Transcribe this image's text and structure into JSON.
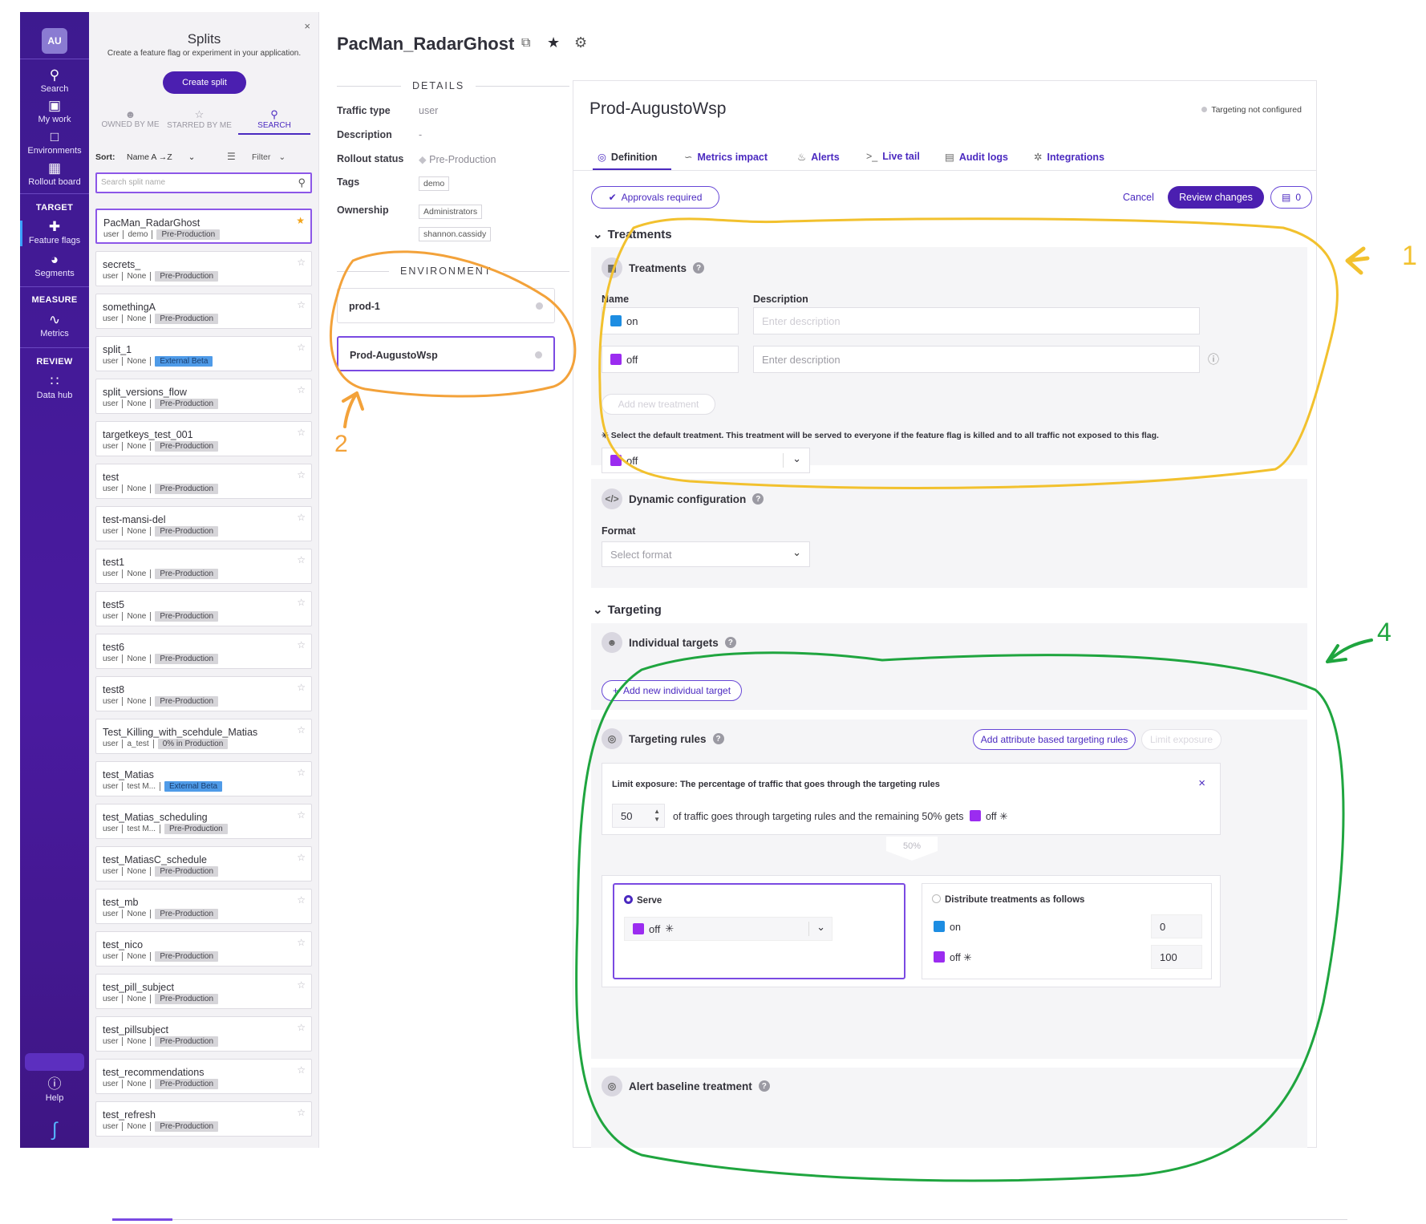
{
  "nav": {
    "avatar": "AU",
    "search": "Search",
    "my_work": "My work",
    "environments": "Environments",
    "rollout_board": "Rollout board",
    "target": "TARGET",
    "feature_flags": "Feature flags",
    "segments": "Segments",
    "measure": "MEASURE",
    "metrics": "Metrics",
    "review": "REVIEW",
    "data_hub": "Data hub",
    "help": "Help"
  },
  "splits_panel": {
    "title": "Splits",
    "subtitle": "Create a feature flag or experiment in your application.",
    "create_button": "Create split",
    "tabs": [
      "OWNED BY ME",
      "STARRED BY ME",
      "SEARCH"
    ],
    "sort_label": "Sort:",
    "sort_value": "Name A →Z",
    "filter_label": "Filter",
    "search_placeholder": "Search split name",
    "items": [
      {
        "name": "PacMan_RadarGhost",
        "type": "user",
        "owner": "demo",
        "env": "Pre-Production",
        "env_style": "grey",
        "starred": true,
        "selected": true
      },
      {
        "name": "secrets_",
        "type": "user",
        "owner": "None",
        "env": "Pre-Production",
        "env_style": "grey"
      },
      {
        "name": "somethingA",
        "type": "user",
        "owner": "None",
        "env": "Pre-Production",
        "env_style": "grey"
      },
      {
        "name": "split_1",
        "type": "user",
        "owner": "None",
        "env": "External Beta",
        "env_style": "blue"
      },
      {
        "name": "split_versions_flow",
        "type": "user",
        "owner": "None",
        "env": "Pre-Production",
        "env_style": "grey"
      },
      {
        "name": "targetkeys_test_001",
        "type": "user",
        "owner": "None",
        "env": "Pre-Production",
        "env_style": "grey"
      },
      {
        "name": "test",
        "type": "user",
        "owner": "None",
        "env": "Pre-Production",
        "env_style": "grey"
      },
      {
        "name": "test-mansi-del",
        "type": "user",
        "owner": "None",
        "env": "Pre-Production",
        "env_style": "grey"
      },
      {
        "name": "test1",
        "type": "user",
        "owner": "None",
        "env": "Pre-Production",
        "env_style": "grey"
      },
      {
        "name": "test5",
        "type": "user",
        "owner": "None",
        "env": "Pre-Production",
        "env_style": "grey"
      },
      {
        "name": "test6",
        "type": "user",
        "owner": "None",
        "env": "Pre-Production",
        "env_style": "grey"
      },
      {
        "name": "test8",
        "type": "user",
        "owner": "None",
        "env": "Pre-Production",
        "env_style": "grey"
      },
      {
        "name": "Test_Killing_with_scehdule_Matias",
        "type": "user",
        "owner": "a_test",
        "env": "0% in Production",
        "env_style": "grey"
      },
      {
        "name": "test_Matias",
        "type": "user",
        "owner": "test M...",
        "env": "External Beta",
        "env_style": "blue"
      },
      {
        "name": "test_Matias_scheduling",
        "type": "user",
        "owner": "test M...",
        "env": "Pre-Production",
        "env_style": "grey"
      },
      {
        "name": "test_MatiasC_schedule",
        "type": "user",
        "owner": "None",
        "env": "Pre-Production",
        "env_style": "grey"
      },
      {
        "name": "test_mb",
        "type": "user",
        "owner": "None",
        "env": "Pre-Production",
        "env_style": "grey"
      },
      {
        "name": "test_nico",
        "type": "user",
        "owner": "None",
        "env": "Pre-Production",
        "env_style": "grey"
      },
      {
        "name": "test_pill_subject",
        "type": "user",
        "owner": "None",
        "env": "Pre-Production",
        "env_style": "grey"
      },
      {
        "name": "test_pillsubject",
        "type": "user",
        "owner": "None",
        "env": "Pre-Production",
        "env_style": "grey"
      },
      {
        "name": "test_recommendations",
        "type": "user",
        "owner": "None",
        "env": "Pre-Production",
        "env_style": "grey"
      },
      {
        "name": "test_refresh",
        "type": "user",
        "owner": "None",
        "env": "Pre-Production",
        "env_style": "grey"
      }
    ]
  },
  "flag": {
    "name": "PacMan_RadarGhost"
  },
  "details": {
    "heading": "DETAILS",
    "traffic_type_label": "Traffic type",
    "traffic_type": "user",
    "description_label": "Description",
    "description": "-",
    "rollout_status_label": "Rollout status",
    "rollout_status": "Pre-Production",
    "tags_label": "Tags",
    "tag": "demo",
    "ownership_label": "Ownership",
    "owners": [
      "Administrators",
      "shannon.cassidy"
    ],
    "environment_heading": "ENVIRONMENT",
    "environments": [
      "prod-1",
      "Prod-AugustoWsp"
    ]
  },
  "main": {
    "env_title": "Prod-AugustoWsp",
    "targeting_status": "Targeting not configured",
    "tabs": [
      "Definition",
      "Metrics impact",
      "Alerts",
      "Live tail",
      "Audit logs",
      "Integrations"
    ],
    "approvals": "Approvals required",
    "cancel": "Cancel",
    "review": "Review changes",
    "count": "0",
    "treatments_section": "Treatments",
    "treatments_card": "Treatments",
    "name_col": "Name",
    "desc_col": "Description",
    "treatments": [
      {
        "name": "on",
        "color": "#1d8de2",
        "placeholder": "Enter description"
      },
      {
        "name": "off",
        "color": "#9b2cf0",
        "placeholder": "Enter description"
      }
    ],
    "add_treatment": "Add new treatment",
    "default_note": "Select the default treatment. This treatment will be served to everyone if the feature flag is killed and to all traffic not exposed to this flag.",
    "default_value": "off",
    "dynamic_config": "Dynamic configuration",
    "format_label": "Format",
    "format_placeholder": "Select format",
    "targeting_section": "Targeting",
    "individual_targets": "Individual targets",
    "add_individual": "Add new individual target",
    "targeting_rules": "Targeting rules",
    "add_attribute": "Add attribute based targeting rules",
    "limit_exposure_btn": "Limit exposure",
    "limit_heading": "Limit exposure: The percentage of traffic that goes through the targeting rules",
    "limit_value": "50",
    "limit_text_1": "of traffic goes through targeting rules and the remaining 50% gets",
    "limit_treatment": "off",
    "split_pct": "50%",
    "serve_label": "Serve",
    "serve_value": "off",
    "distribute_label": "Distribute treatments as follows",
    "distribute": [
      {
        "name": "on",
        "value": "0"
      },
      {
        "name": "off",
        "value": "100"
      }
    ],
    "alert_baseline": "Alert baseline treatment"
  },
  "annotations": {
    "one": "1",
    "two": "2",
    "four": "4"
  },
  "colors": {
    "nav": "#4a1aa0",
    "accent": "#4b2ac0",
    "on": "#1d8de2",
    "off": "#9b2cf0",
    "yellow_annotation": "#f2c12e",
    "orange_annotation": "#f3a23a",
    "green_annotation": "#1fa53f"
  }
}
